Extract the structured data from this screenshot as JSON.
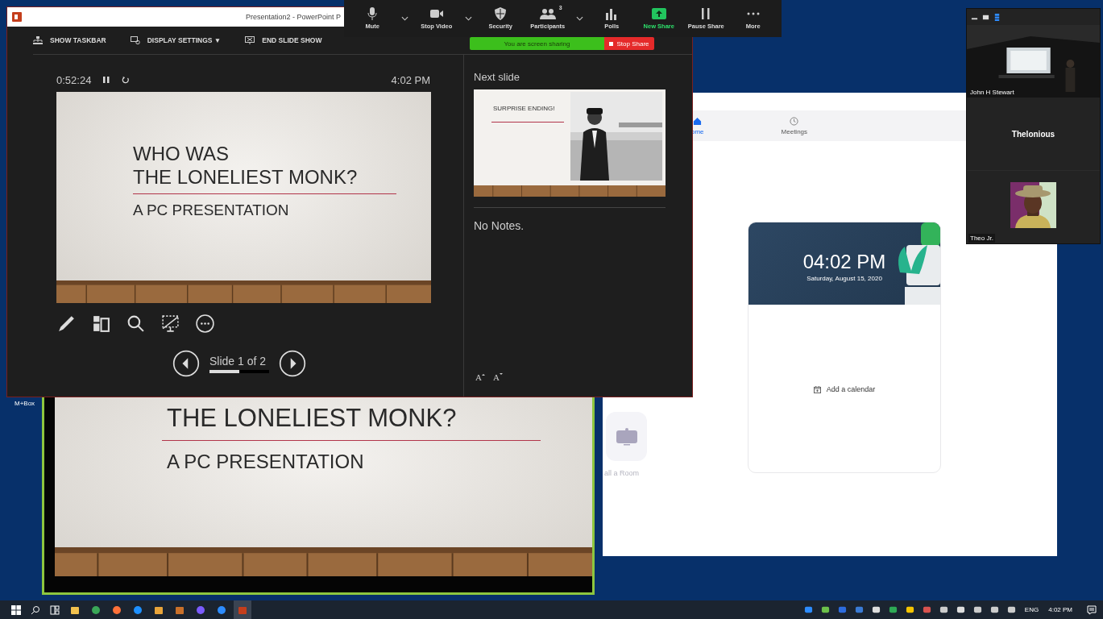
{
  "powerpoint": {
    "title": "Presentation2 - PowerPoint P",
    "toolbar": [
      {
        "label": "SHOW TASKBAR",
        "kind": "taskbar"
      },
      {
        "label": "DISPLAY SETTINGS ▼",
        "kind": "display"
      },
      {
        "label": "END SLIDE SHOW",
        "kind": "end"
      }
    ],
    "timer": "0:52:24",
    "clock": "4:02 PM",
    "slide": {
      "lines": [
        "WHO WAS",
        "THE LONELIEST MONK?"
      ],
      "subtitle": "A PC PRESENTATION"
    },
    "slide_counter": "Slide 1 of 2",
    "progress": {
      "level": 0.5
    },
    "next_slide_heading": "Next slide",
    "next_slide": {
      "title": "SURPRISE ENDING!"
    },
    "notes": "No Notes.",
    "font_buttons": [
      {
        "label": "A",
        "kind": "increase"
      },
      {
        "label": "A",
        "kind": "decrease"
      }
    ]
  },
  "meeting_toolbar": {
    "buttons": [
      {
        "label": "Mute",
        "kind": "mic",
        "menu": true
      },
      {
        "label": "Stop Video",
        "kind": "video",
        "menu": true
      },
      {
        "label": "Security",
        "kind": "shield",
        "menu": false
      },
      {
        "label": "Participants",
        "kind": "people",
        "menu": true,
        "count": "3"
      },
      {
        "label": "Polls",
        "kind": "polls",
        "menu": false
      },
      {
        "label": "New Share",
        "kind": "share",
        "menu": false
      },
      {
        "label": "Pause Share",
        "kind": "pause",
        "menu": false
      },
      {
        "label": "More",
        "kind": "more",
        "menu": false
      }
    ]
  },
  "share_banner": {
    "text": "You are screen sharing",
    "button": "Stop Share"
  },
  "desktop_icon_label": "M+Box",
  "shared_screen": {
    "title": "THE LONELIEST MONK?",
    "subtitle": "A PC PRESENTATION"
  },
  "meeting_home": {
    "tabs": [
      {
        "label": "ome",
        "kind": "home",
        "selected": true
      },
      {
        "label": "Meetings",
        "kind": "clock",
        "selected": false
      }
    ],
    "clock": "04:02 PM",
    "date": "Saturday, August 15, 2020",
    "add_calendar": "Add a calendar",
    "room_label": "all a Room"
  },
  "gallery": {
    "participants": [
      {
        "name": "John H Stewart",
        "kind": "video"
      },
      {
        "name": "Thelonious",
        "kind": "name"
      },
      {
        "name": "Theo Jr."
      }
    ]
  },
  "taskbar": {
    "apps": [
      {
        "kind": "files",
        "selected": false
      },
      {
        "kind": "chrome",
        "selected": false
      },
      {
        "kind": "firefox",
        "selected": false
      },
      {
        "kind": "ie",
        "selected": false
      },
      {
        "kind": "pen",
        "selected": false
      },
      {
        "kind": "webex",
        "selected": false
      },
      {
        "kind": "drop",
        "selected": false
      },
      {
        "kind": "zoom",
        "selected": false
      },
      {
        "kind": "powerpoint",
        "selected": true
      }
    ],
    "language": "ENG",
    "time": "4:02 PM"
  }
}
